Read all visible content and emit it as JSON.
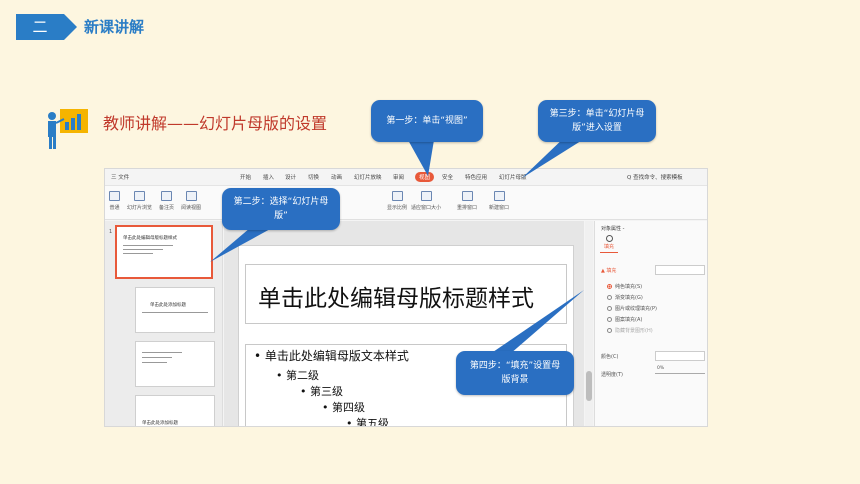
{
  "header": {
    "number": "二",
    "title": "新课讲解"
  },
  "lesson": {
    "title": "教师讲解——幻灯片母版的设置"
  },
  "callouts": {
    "step1": "第一步：单击“视图”",
    "step2": "第二步：选择“幻灯片母版”",
    "step3": "第三步：单击“幻灯片母版”进入设置",
    "step4": "第四步：“填充”设置母版背景"
  },
  "app": {
    "menu": [
      "三 文件",
      "开始",
      "插入",
      "设计",
      "切换",
      "动画",
      "幻灯片放映",
      "审阅",
      "视图",
      "安全",
      "特色应用",
      "幻灯片母版"
    ],
    "active_menu": "视图",
    "search": "Q 查找命令、搜索模板",
    "ribbon": [
      "普通",
      "幻灯片浏览",
      "备注页",
      "阅读视图",
      "显示比例",
      "适应窗口大小",
      "重排窗口",
      "新建窗口"
    ],
    "thumbnails": [
      {
        "num": "1",
        "title": "单击此处编辑母版标题样式"
      },
      {
        "num": "",
        "title": "单击此处添加标题"
      },
      {
        "num": "",
        "title": ""
      },
      {
        "num": "",
        "title": "单击此处添加标题"
      }
    ],
    "slide": {
      "title": "单击此处编辑母版标题样式",
      "levels": [
        "• 单击此处编辑母版文本样式",
        "• 第二级",
        "• 第三级",
        "• 第四级",
        "• 第五级"
      ]
    },
    "panel": {
      "title": "对象属性 -",
      "tab": "填充",
      "fill_heading": "▲ 填充",
      "options": [
        "纯色填充(S)",
        "渐变填充(G)",
        "图片或纹理填充(P)",
        "图案填充(A)",
        "隐藏背景图形(H)"
      ],
      "selected_option": "纯色填充(S)",
      "color_label": "颜色(C)",
      "transparency_label": "透明度(T)",
      "transparency_value": "0%"
    }
  },
  "colors": {
    "accent": "#2a7dc6",
    "callout": "#2a6fc2",
    "title_red": "#c0392b",
    "active_tab": "#e8593a",
    "background": "#fdf6e0"
  }
}
